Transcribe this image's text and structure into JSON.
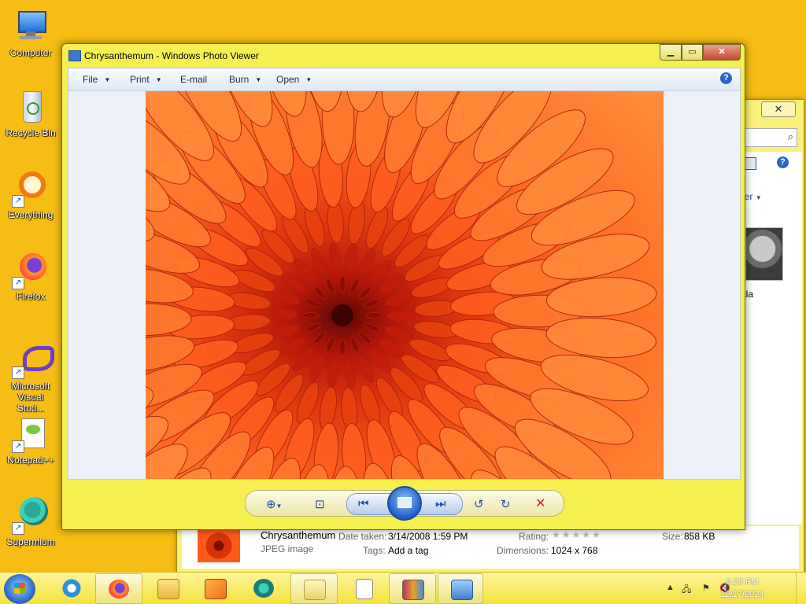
{
  "desktop": {
    "icons": [
      {
        "label": "Computer"
      },
      {
        "label": "Recycle Bin"
      },
      {
        "label": "Everything"
      },
      {
        "label": "Firefox"
      },
      {
        "label": "Microsoft Visual Stud..."
      },
      {
        "label": "Notepad++"
      },
      {
        "label": "Supermium"
      }
    ]
  },
  "viewer": {
    "title": "Chrysanthemum - Windows Photo Viewer",
    "menu": {
      "file": "File",
      "print": "Print",
      "email": "E-mail",
      "burn": "Burn",
      "open": "Open"
    },
    "help": "?",
    "controls": {
      "zoom_icon": "zoom-icon",
      "actual_size_icon": "actual-size-icon",
      "previous_icon": "previous-icon",
      "slideshow_icon": "slideshow-icon",
      "next_icon": "next-icon",
      "rotate_ccw_icon": "rotate-counterclockwise-icon",
      "rotate_cw_icon": "rotate-clockwise-icon",
      "delete_icon": "delete-icon"
    }
  },
  "explorer": {
    "slider_label": "der",
    "koala_label": "ala",
    "details": {
      "name": "Chrysanthemum",
      "type": "JPEG image",
      "date_label": "Date taken:",
      "date_value": "3/14/2008 1:59 PM",
      "tags_label": "Tags:",
      "tags_value": "Add a tag",
      "rating_label": "Rating:",
      "rating_stars": "★★★★★",
      "dimensions_label": "Dimensions:",
      "dimensions_value": "1024 x 768",
      "size_label": "Size:",
      "size_value": "858 KB"
    }
  },
  "taskbar": {
    "clock_time": "8:26 PM",
    "clock_date": "12/17/2024"
  },
  "colors": {
    "desktop": "#f6bd14",
    "window_frame": "#f5f04f",
    "accent": "#1f4fa6"
  }
}
